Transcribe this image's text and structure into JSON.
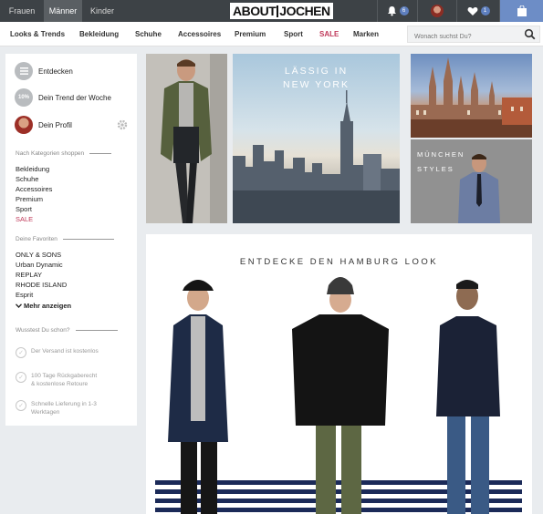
{
  "gender_tabs": [
    {
      "label": "Frauen"
    },
    {
      "label": "Männer"
    },
    {
      "label": "Kinder"
    }
  ],
  "logo": {
    "left": "ABOUT",
    "right": "JOCHEN"
  },
  "header": {
    "notifications_count": "6",
    "wishlist_count": "1"
  },
  "categories": [
    "Looks & Trends",
    "Bekleidung",
    "Schuhe",
    "Accessoires",
    "Premium",
    "Sport",
    "SALE",
    "Marken"
  ],
  "search": {
    "placeholder": "Wonach suchst Du?"
  },
  "sidebar": {
    "items": [
      {
        "label": "Entdecken",
        "icon": "list-icon"
      },
      {
        "label": "Dein Trend der Woche",
        "icon_text": "10%"
      },
      {
        "label": "Dein Profil",
        "icon": "avatar"
      }
    ],
    "categories_heading": "Nach Kategorien shoppen",
    "category_links": [
      "Bekleidung",
      "Schuhe",
      "Accessoires",
      "Premium",
      "Sport",
      "SALE"
    ],
    "favorites_heading": "Deine Favoriten",
    "favorite_links": [
      "ONLY & SONS",
      "Urban Dynamic",
      "REPLAY",
      "RHODE ISLAND",
      "Esprit"
    ],
    "more_label": "Mehr anzeigen",
    "tips_heading": "Wusstest Du schon?",
    "tips": [
      {
        "line1": "Der Versand ist kostenlos",
        "line2": ""
      },
      {
        "line1": "100 Tage Rückgaberecht",
        "line2": "& kostenlose Retoure"
      },
      {
        "line1": "Schnelle Lieferung in 1-3",
        "line2": "Werktagen"
      }
    ]
  },
  "tiles": {
    "nyc_line1": "LÄSSIG IN",
    "nyc_line2": "NEW YORK",
    "munich_line1": "MÜNCHEN",
    "munich_line2": "STYLES",
    "hamburg_title": "ENTDECKE DEN HAMBURG LOOK"
  },
  "colors": {
    "accent": "#6d8dc6",
    "sale": "#c0395a",
    "topbar": "#3d4246"
  }
}
